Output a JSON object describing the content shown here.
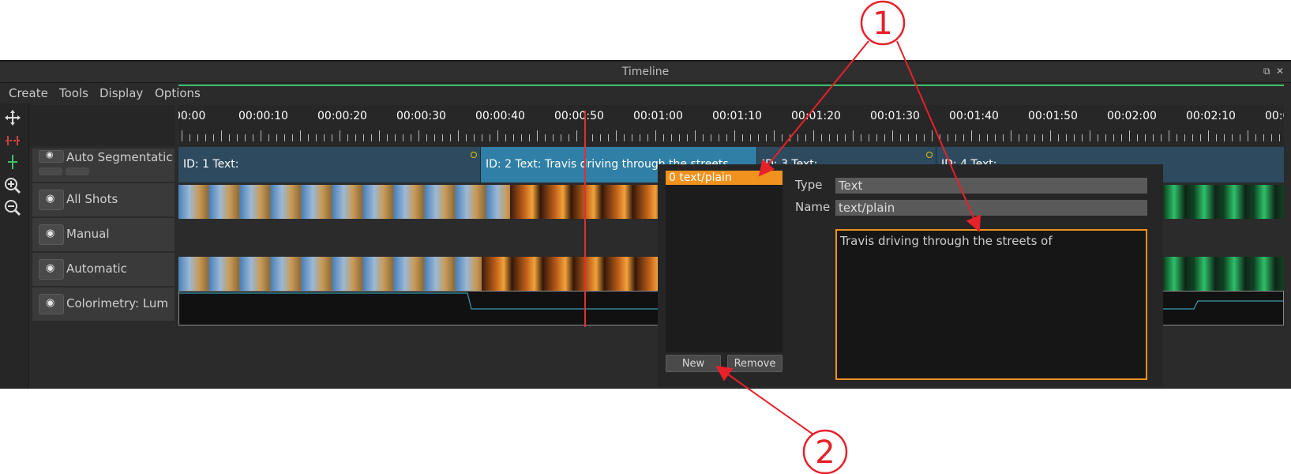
{
  "window": {
    "title": "Timeline",
    "restore_icon": "⧉",
    "close_icon": "✕"
  },
  "menu": {
    "create": "Create",
    "tools": "Tools",
    "display": "Display",
    "options": "Options"
  },
  "ruler": {
    "labels": [
      "00:00",
      "00:00:10",
      "00:00:20",
      "00:00:30",
      "00:00:40",
      "00:00:50",
      "00:01:00",
      "00:01:10",
      "00:01:20",
      "00:01:30",
      "00:01:40",
      "00:01:50",
      "00:02:00",
      "00:02:10",
      "00:0"
    ]
  },
  "tracks": [
    {
      "name": "Auto Segmentatic",
      "icon": "eye-icon"
    },
    {
      "name": "All Shots",
      "icon": "eye-icon"
    },
    {
      "name": "Manual",
      "icon": "eye-icon"
    },
    {
      "name": "Automatic",
      "icon": "eye-icon"
    },
    {
      "name": "Colorimetry: Lum",
      "icon": "eye-icon"
    }
  ],
  "segments": [
    {
      "text": "ID: 1    Text:"
    },
    {
      "text": "ID: 2    Text: Travis driving through the streets"
    },
    {
      "text": "ID: 3    Text:"
    },
    {
      "text": "ID: 4    Text:"
    }
  ],
  "editor": {
    "list_item": "0 text/plain",
    "type_label": "Type",
    "type_value": "Text",
    "name_label": "Name",
    "name_value": "text/plain",
    "content": "Travis driving through the streets of",
    "new_button": "New",
    "remove_button": "Remove"
  },
  "callouts": {
    "one": "1",
    "two": "2"
  },
  "colors": {
    "accent": "#f0921d",
    "callout": "#e8202a",
    "segment_selected": "#2f7fa6",
    "segment": "#2d4a5e",
    "ruler_line": "#3ec06a",
    "playhead": "#e03030"
  }
}
